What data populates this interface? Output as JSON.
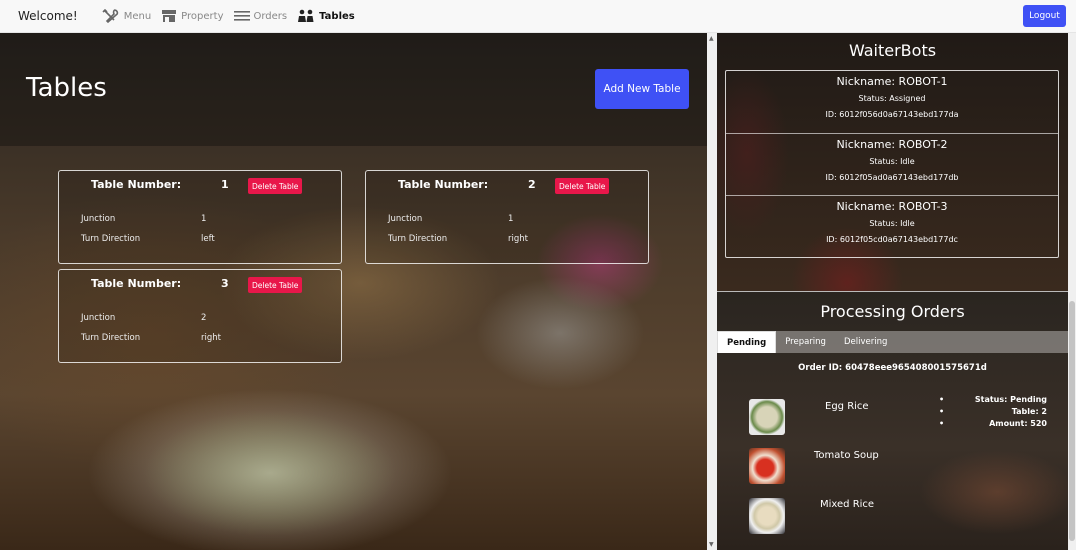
{
  "nav": {
    "welcome": "Welcome!",
    "items": [
      {
        "label": "Menu",
        "icon": "utensils-icon",
        "active": false
      },
      {
        "label": "Property",
        "icon": "store-icon",
        "active": false
      },
      {
        "label": "Orders",
        "icon": "list-icon",
        "active": false
      },
      {
        "label": "Tables",
        "icon": "people-icon",
        "active": true
      }
    ],
    "logout": "Logout"
  },
  "tables_page": {
    "title": "Tables",
    "add_button": "Add New Table",
    "number_label": "Table Number:",
    "delete_label": "Delete Table",
    "junction_label": "Junction",
    "turn_label": "Turn Direction",
    "tables": [
      {
        "number": "1",
        "junction": "1",
        "turn": "left"
      },
      {
        "number": "2",
        "junction": "1",
        "turn": "right"
      },
      {
        "number": "3",
        "junction": "2",
        "turn": "right"
      }
    ]
  },
  "waiterbots": {
    "title": "WaiterBots",
    "items": [
      {
        "nickname": "Nickname: ROBOT-1",
        "status": "Status: Assigned",
        "id": "ID: 6012f056d0a67143ebd177da"
      },
      {
        "nickname": "Nickname: ROBOT-2",
        "status": "Status: Idle",
        "id": "ID: 6012f05ad0a67143ebd177db"
      },
      {
        "nickname": "Nickname: ROBOT-3",
        "status": "Status: Idle",
        "id": "ID: 6012f05cd0a67143ebd177dc"
      }
    ]
  },
  "processing": {
    "title": "Processing Orders",
    "tabs": [
      "Pending",
      "Preparing",
      "Delivering"
    ],
    "order_id": "Order ID: 60478eee965408001575671d",
    "items": [
      "Egg Rice",
      "Tomato Soup",
      "Mixed Rice"
    ],
    "details": [
      "Status: Pending",
      "Table: 2",
      "Amount: 520"
    ]
  },
  "colors": {
    "accent": "#3f51f5",
    "danger": "#e8174a"
  }
}
